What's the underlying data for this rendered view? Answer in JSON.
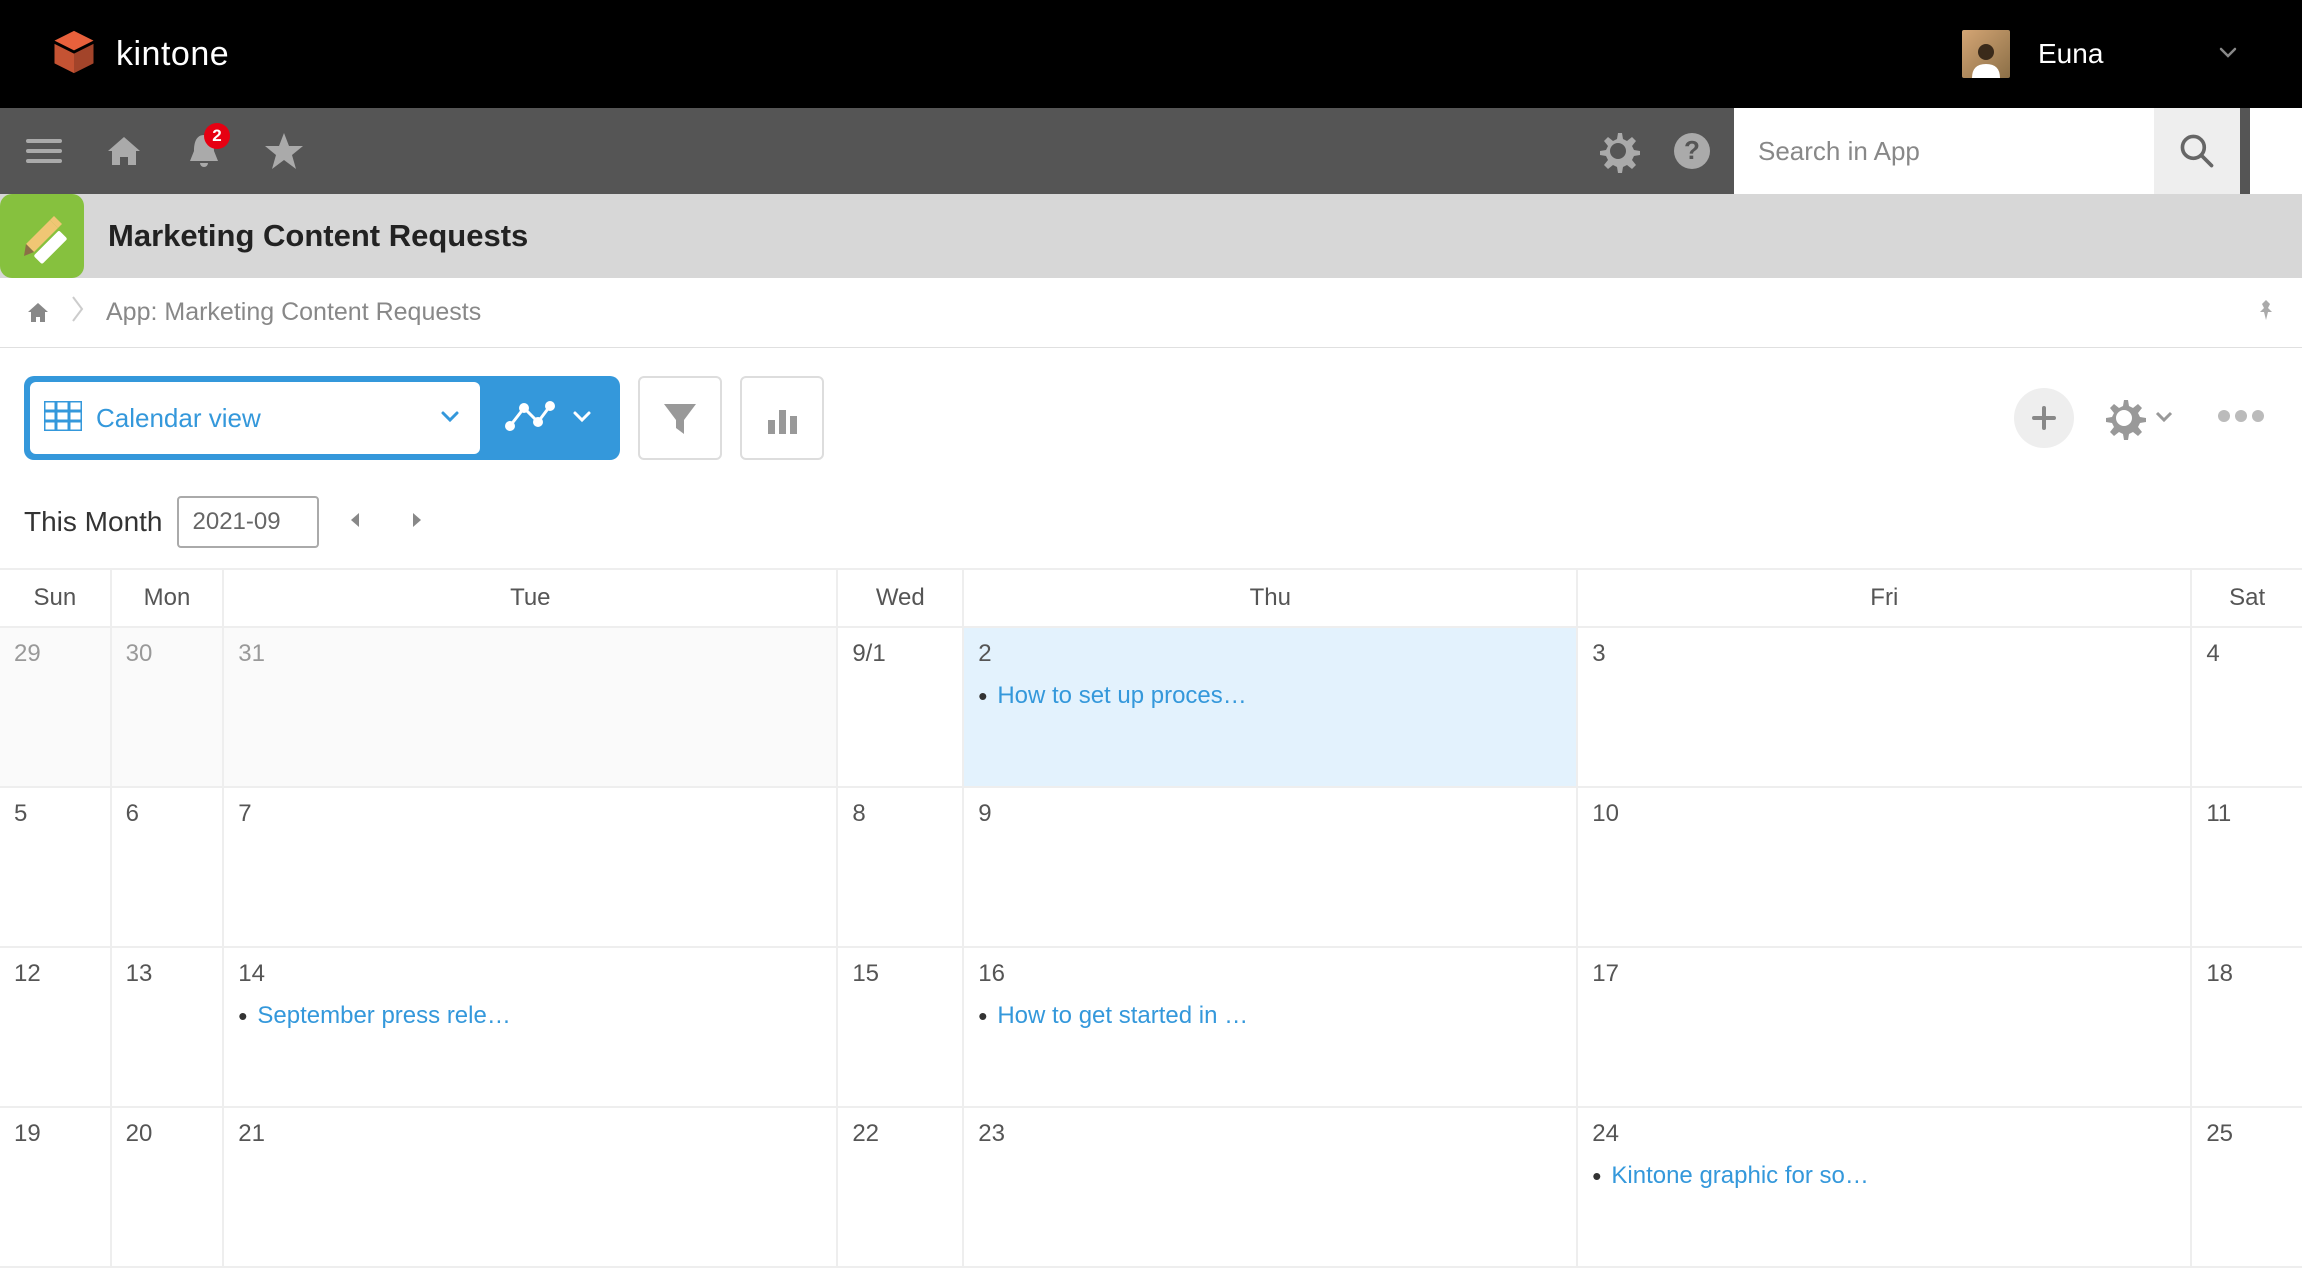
{
  "brand": {
    "name": "kintone"
  },
  "user": {
    "name": "Euna"
  },
  "notifications": {
    "count": "2"
  },
  "search": {
    "placeholder": "Search in App"
  },
  "app": {
    "title": "Marketing Content Requests"
  },
  "breadcrumb": {
    "text": "App: Marketing Content Requests"
  },
  "view": {
    "selected_label": "Calendar view"
  },
  "monthnav": {
    "label": "This Month",
    "value": "2021-09"
  },
  "calendar": {
    "day_headers": [
      "Sun",
      "Mon",
      "Tue",
      "Wed",
      "Thu",
      "Fri",
      "Sat"
    ],
    "weeks": [
      [
        {
          "num": "29",
          "other": true
        },
        {
          "num": "30",
          "other": true
        },
        {
          "num": "31",
          "other": true
        },
        {
          "num": "9/1"
        },
        {
          "num": "2",
          "today": true,
          "events": [
            "How to set up process …"
          ]
        },
        {
          "num": "3"
        },
        {
          "num": "4"
        }
      ],
      [
        {
          "num": "5"
        },
        {
          "num": "6"
        },
        {
          "num": "7"
        },
        {
          "num": "8"
        },
        {
          "num": "9"
        },
        {
          "num": "10"
        },
        {
          "num": "11"
        }
      ],
      [
        {
          "num": "12"
        },
        {
          "num": "13"
        },
        {
          "num": "14",
          "events": [
            "September press relea…"
          ]
        },
        {
          "num": "15"
        },
        {
          "num": "16",
          "events": [
            "How to get started in K…"
          ]
        },
        {
          "num": "17"
        },
        {
          "num": "18"
        }
      ],
      [
        {
          "num": "19"
        },
        {
          "num": "20"
        },
        {
          "num": "21"
        },
        {
          "num": "22"
        },
        {
          "num": "23"
        },
        {
          "num": "24",
          "events": [
            "Kintone graphic for soc…"
          ]
        },
        {
          "num": "25"
        }
      ]
    ]
  }
}
